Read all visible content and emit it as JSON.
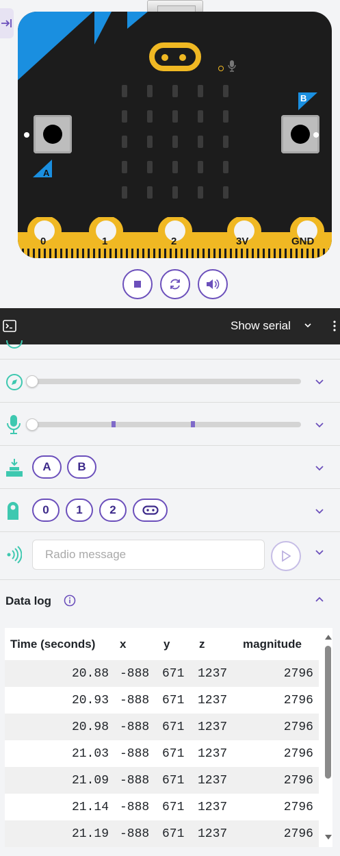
{
  "simulator": {
    "pins": [
      "0",
      "1",
      "2",
      "3V",
      "GND"
    ],
    "button_a_label": "A",
    "button_b_label": "B",
    "controls": [
      "stop",
      "reset",
      "sound"
    ]
  },
  "serial": {
    "toggle_label": "Show serial"
  },
  "sensors": {
    "compass_value": 0,
    "sound_level": 0,
    "buttons": [
      "A",
      "B"
    ],
    "touch_pins": [
      "0",
      "1",
      "2"
    ],
    "radio": {
      "placeholder": "Radio message"
    }
  },
  "data_log": {
    "title": "Data log",
    "columns": [
      "Time (seconds)",
      "x",
      "y",
      "z",
      "magnitude"
    ],
    "rows": [
      [
        "20.88",
        "-888",
        "671",
        "1237",
        "2796"
      ],
      [
        "20.93",
        "-888",
        "671",
        "1237",
        "2796"
      ],
      [
        "20.98",
        "-888",
        "671",
        "1237",
        "2796"
      ],
      [
        "21.03",
        "-888",
        "671",
        "1237",
        "2796"
      ],
      [
        "21.09",
        "-888",
        "671",
        "1237",
        "2796"
      ],
      [
        "21.14",
        "-888",
        "671",
        "1237",
        "2796"
      ],
      [
        "21.19",
        "-888",
        "671",
        "1237",
        "2796"
      ]
    ]
  },
  "colors": {
    "accent": "#6b4fbb",
    "board": "#1c1c1c",
    "pin_gold": "#f0b823",
    "sensor_icon": "#3ec8b0",
    "corner_blue": "#1a8fe0"
  }
}
